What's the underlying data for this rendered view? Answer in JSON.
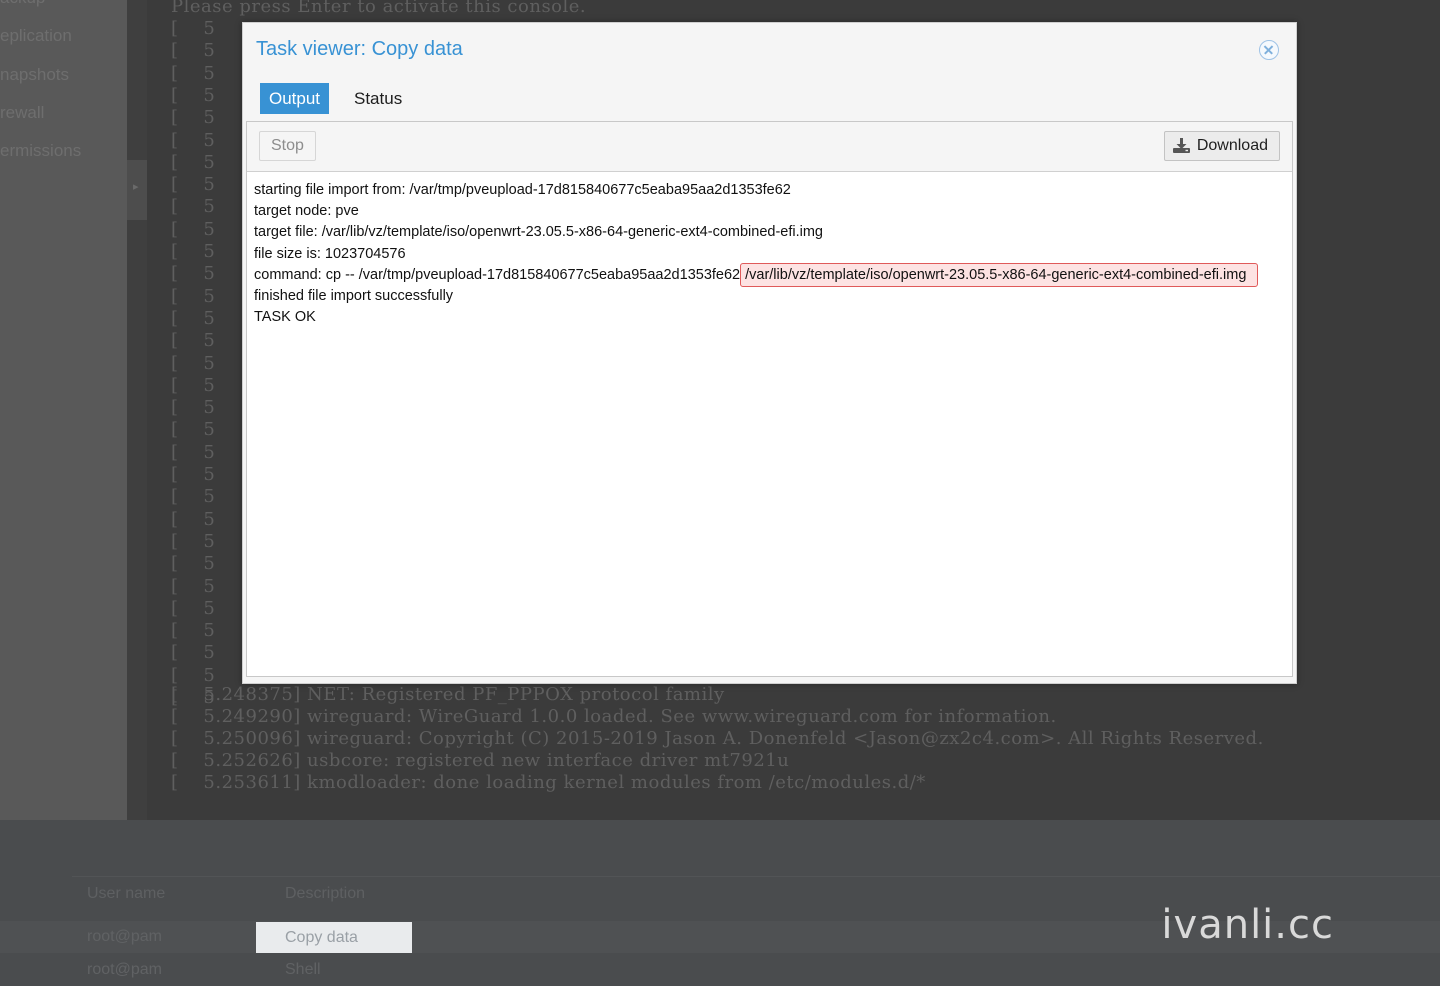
{
  "background": {
    "sidebar_items": [
      "ackup",
      "eplication",
      "napshots",
      "rewall",
      "ermissions"
    ],
    "console_header": "Please press Enter to activate this console.",
    "console_prefix": "5",
    "console_tail": [
      "5.248375] NET: Registered PF_PPPOX protocol family",
      "5.249290] wireguard: WireGuard 1.0.0 loaded. See www.wireguard.com for information.",
      "5.250096] wireguard: Copyright (C) 2015-2019 Jason A. Donenfeld <Jason@zx2c4.com>. All Rights Reserved.",
      "5.252626] usbcore: registered new interface driver mt7921u",
      "5.253611] kmodloader: done loading kernel modules from /etc/modules.d/*"
    ],
    "task_grid": {
      "columns": [
        "User name",
        "Description"
      ],
      "rows": [
        {
          "user": "root@pam",
          "description": "Copy data"
        },
        {
          "user": "root@pam",
          "description": "Shell"
        }
      ]
    }
  },
  "watermark": "ivanli.cc",
  "modal": {
    "title": "Task viewer: Copy data",
    "tabs": [
      {
        "label": "Output",
        "active": true
      },
      {
        "label": "Status",
        "active": false
      }
    ],
    "toolbar": {
      "stop_label": "Stop",
      "download_label": "Download"
    },
    "log_lines": [
      "starting file import from: /var/tmp/pveupload-17d815840677c5eaba95aa2d1353fe62",
      "target node: pve",
      "target file: /var/lib/vz/template/iso/openwrt-23.05.5-x86-64-generic-ext4-combined-efi.img",
      "file size is: 1023704576",
      "finished file import successfully",
      "TASK OK"
    ],
    "command_line": {
      "prefix": "command: cp -- /var/tmp/pveupload-17d815840677c5eaba95aa2d1353fe62",
      "highlighted": "/var/lib/vz/template/iso/openwrt-23.05.5-x86-64-generic-ext4-combined-efi.img"
    }
  },
  "colors": {
    "accent": "#3892d4",
    "highlight_border": "#e05a5a",
    "highlight_fill": "#fde3e3"
  }
}
